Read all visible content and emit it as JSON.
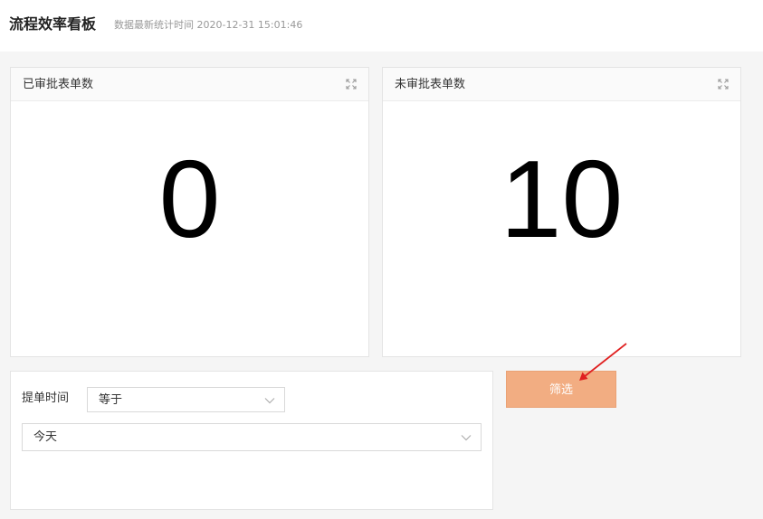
{
  "header": {
    "title": "流程效率看板",
    "update_time": "数据最新统计时间 2020-12-31 15:01:46"
  },
  "cards": [
    {
      "title": "已审批表单数",
      "value": "0",
      "icon": "expand-icon"
    },
    {
      "title": "未审批表单数",
      "value": "10",
      "icon": "expand-icon"
    }
  ],
  "filter": {
    "field_label": "提单时间",
    "operator_value": "等于",
    "date_value": "今天",
    "button_label": "筛选"
  },
  "colors": {
    "page_background": "#f5f5f5",
    "button_fill": "#f2ad82",
    "annotation_arrow": "#e02020"
  }
}
